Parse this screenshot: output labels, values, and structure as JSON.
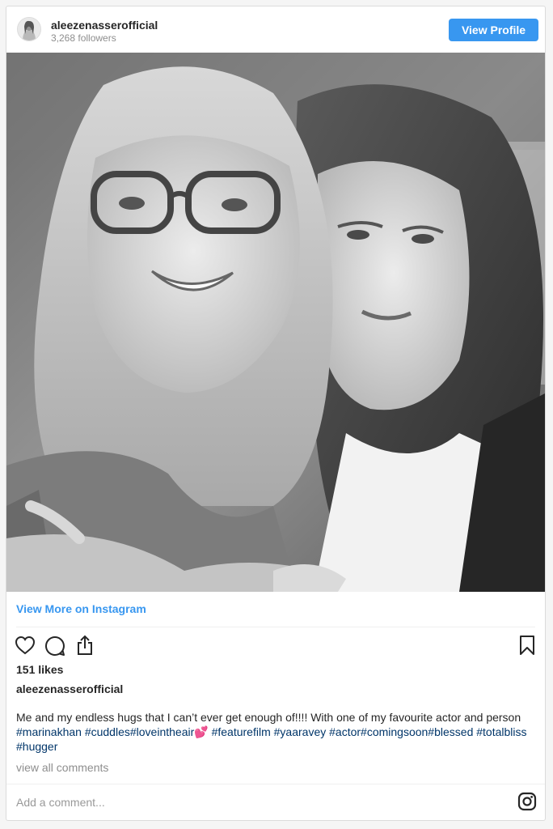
{
  "header": {
    "username": "aleezenasserofficial",
    "followers": "3,268 followers",
    "view_profile_label": "View Profile"
  },
  "photo": {
    "style": "black-and-white portrait"
  },
  "links": {
    "view_more": "View More on Instagram"
  },
  "actions": {
    "icons": [
      "heart-icon",
      "comment-icon",
      "share-icon",
      "bookmark-icon"
    ]
  },
  "post": {
    "likes": "151 likes",
    "caption_username": "aleezenasserofficial",
    "caption_text": "Me and my endless hugs that I can’t ever get enough of!!!! With one of my favourite actor and person ",
    "tags": {
      "t1": "#marinakhan",
      "t2": "#cuddles#loveintheair",
      "emoji": "💕",
      "t3": "#featurefilm",
      "t4": "#yaaravey",
      "t5": "#actor#comingsoon#blessed",
      "t6": "#totalbliss",
      "t7": "#hugger"
    },
    "view_all_comments": "view all comments"
  },
  "comment": {
    "placeholder": "Add a comment..."
  },
  "colors": {
    "accent": "#3897f0",
    "hashtag": "#003569",
    "muted": "#8e8e8e",
    "text": "#262626"
  }
}
